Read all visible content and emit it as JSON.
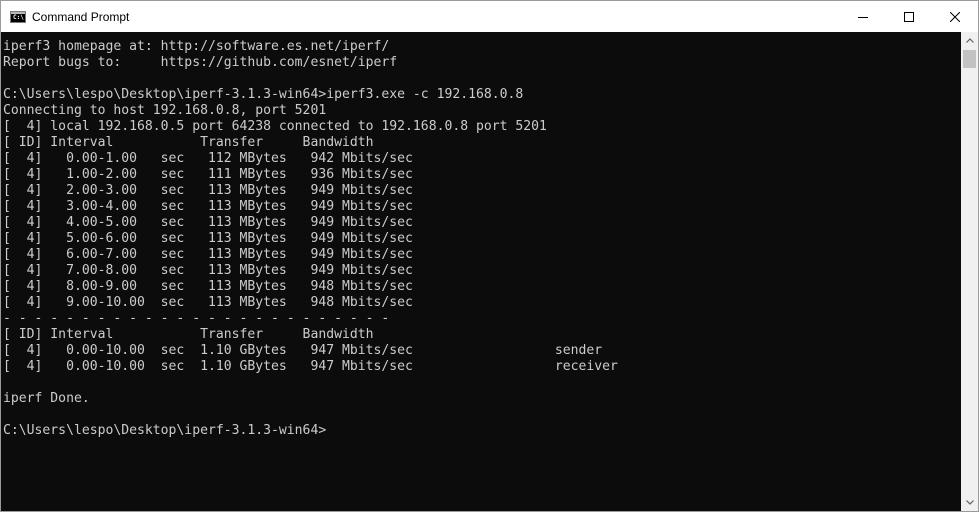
{
  "window": {
    "title": "Command Prompt",
    "icon": "cmd-console-icon",
    "icon_text": "C:\\"
  },
  "controls": {
    "minimize_icon": "minimize-icon",
    "maximize_icon": "maximize-icon",
    "close_icon": "close-icon"
  },
  "console": {
    "lines": [
      "iperf3 homepage at: http://software.es.net/iperf/",
      "Report bugs to:     https://github.com/esnet/iperf",
      "",
      "C:\\Users\\lespo\\Desktop\\iperf-3.1.3-win64>iperf3.exe -c 192.168.0.8",
      "Connecting to host 192.168.0.8, port 5201",
      "[  4] local 192.168.0.5 port 64238 connected to 192.168.0.8 port 5201",
      "[ ID] Interval           Transfer     Bandwidth",
      "[  4]   0.00-1.00   sec   112 MBytes   942 Mbits/sec",
      "[  4]   1.00-2.00   sec   111 MBytes   936 Mbits/sec",
      "[  4]   2.00-3.00   sec   113 MBytes   949 Mbits/sec",
      "[  4]   3.00-4.00   sec   113 MBytes   949 Mbits/sec",
      "[  4]   4.00-5.00   sec   113 MBytes   949 Mbits/sec",
      "[  4]   5.00-6.00   sec   113 MBytes   949 Mbits/sec",
      "[  4]   6.00-7.00   sec   113 MBytes   949 Mbits/sec",
      "[  4]   7.00-8.00   sec   113 MBytes   949 Mbits/sec",
      "[  4]   8.00-9.00   sec   113 MBytes   948 Mbits/sec",
      "[  4]   9.00-10.00  sec   113 MBytes   948 Mbits/sec",
      "- - - - - - - - - - - - - - - - - - - - - - - - -",
      "[ ID] Interval           Transfer     Bandwidth",
      "[  4]   0.00-10.00  sec  1.10 GBytes   947 Mbits/sec                  sender",
      "[  4]   0.00-10.00  sec  1.10 GBytes   947 Mbits/sec                  receiver",
      "",
      "iperf Done.",
      "",
      "C:\\Users\\lespo\\Desktop\\iperf-3.1.3-win64>"
    ]
  },
  "scrollbar": {
    "up_icon": "scroll-up-arrow-icon",
    "down_icon": "scroll-down-arrow-icon"
  },
  "colors": {
    "console_background": "#0c0c0c",
    "console_text": "#cccccc",
    "titlebar_background": "#ffffff",
    "scrollbar_track": "#f0f0f0",
    "scrollbar_thumb": "#c2c2c2"
  }
}
